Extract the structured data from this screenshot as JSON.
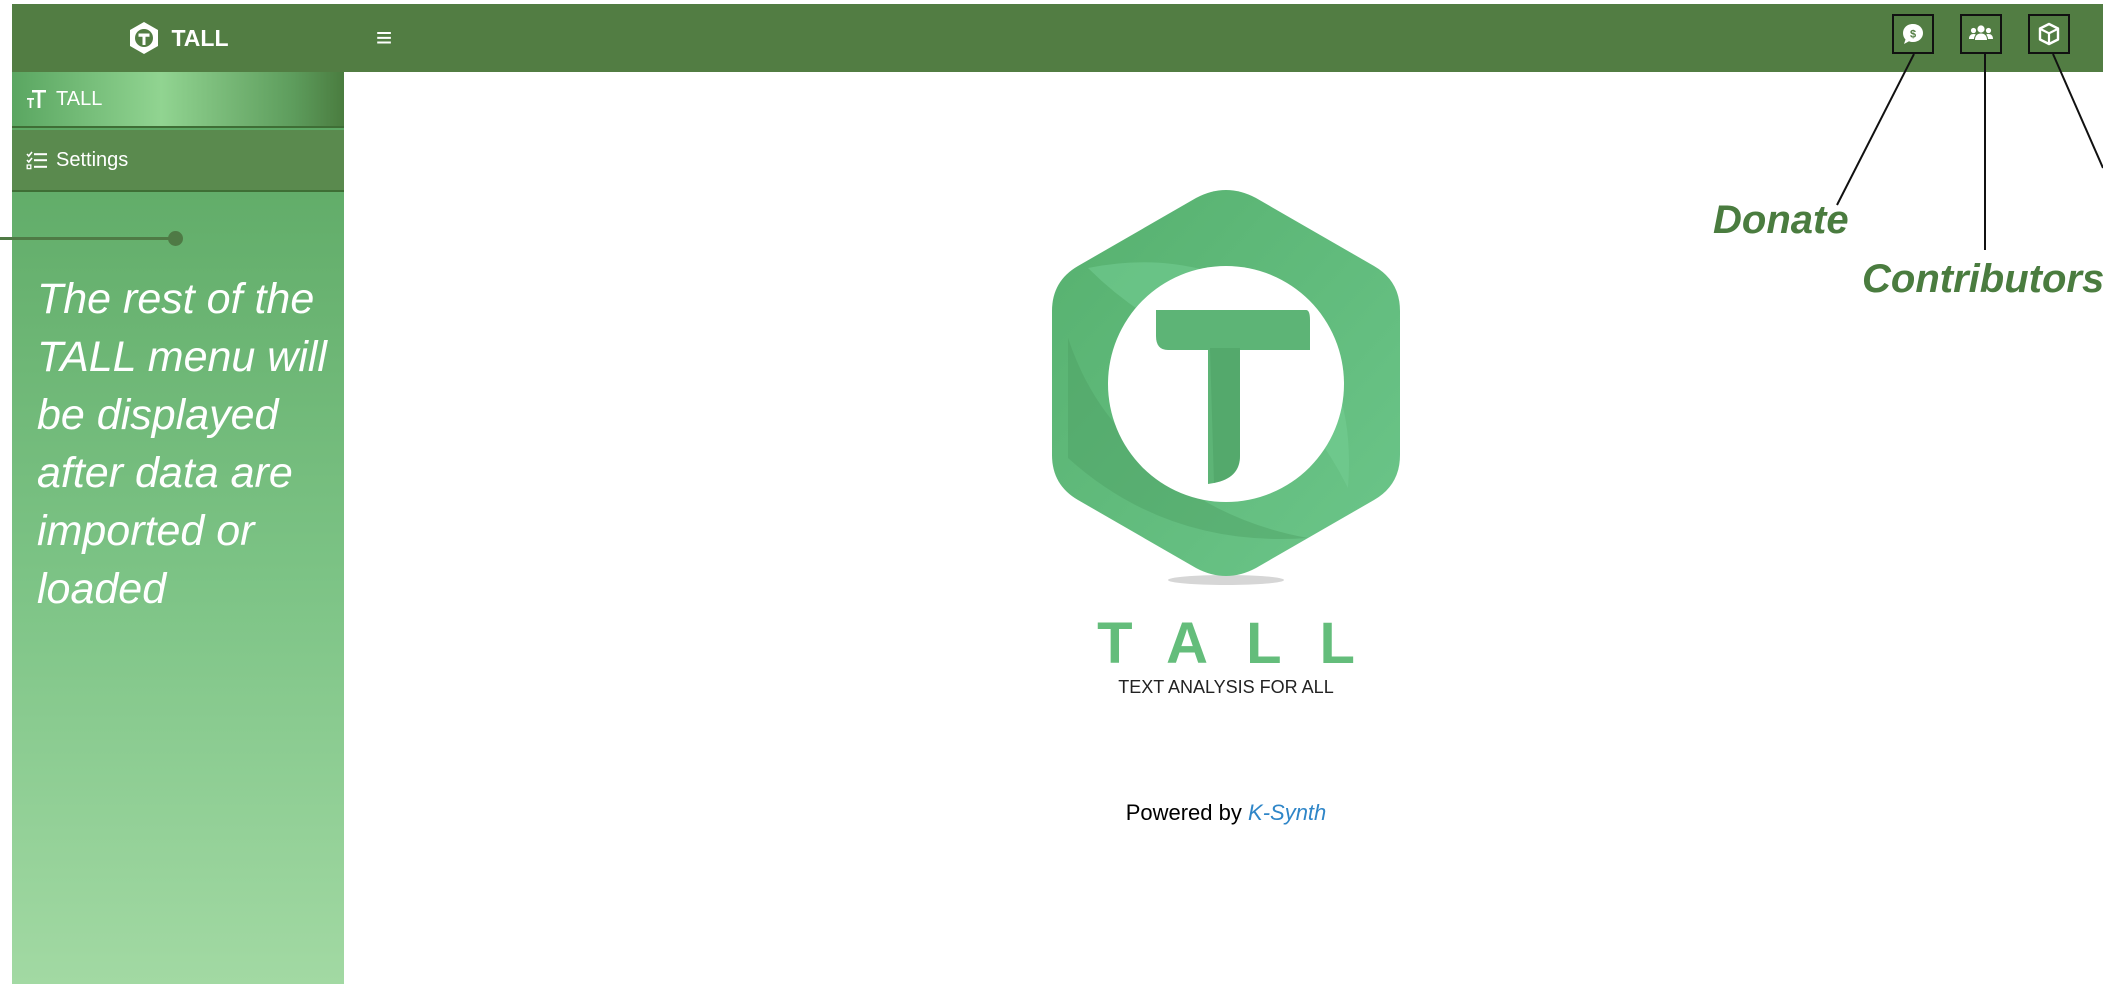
{
  "header": {
    "brand_label": "TALL",
    "menu_icon": "hamburger-icon",
    "nav_buttons": [
      {
        "icon": "donate-icon"
      },
      {
        "icon": "contributors-icon"
      },
      {
        "icon": "cube-icon"
      }
    ]
  },
  "sidebar": {
    "items": [
      {
        "label": "TALL",
        "icon": "tall-text-icon",
        "active": true
      },
      {
        "label": "Settings",
        "icon": "checklist-icon",
        "active": false
      }
    ],
    "note": "The rest of the TALL menu will be displayed after data are imported or loaded"
  },
  "main": {
    "logo_title": "TALL",
    "logo_subtitle": "TEXT ANALYSIS FOR ALL",
    "powered_prefix": "Powered by",
    "powered_link": "K-Synth"
  },
  "annotations": {
    "donate": "Donate",
    "contributors": "Contributors"
  },
  "colors": {
    "topbar": "#527d43",
    "sidebar_top": "#5aa661",
    "sidebar_bottom": "#a2d9a3",
    "logo_green": "#64bd7b",
    "annotation_green": "#4a7c3f",
    "link_blue": "#2f86c8"
  }
}
